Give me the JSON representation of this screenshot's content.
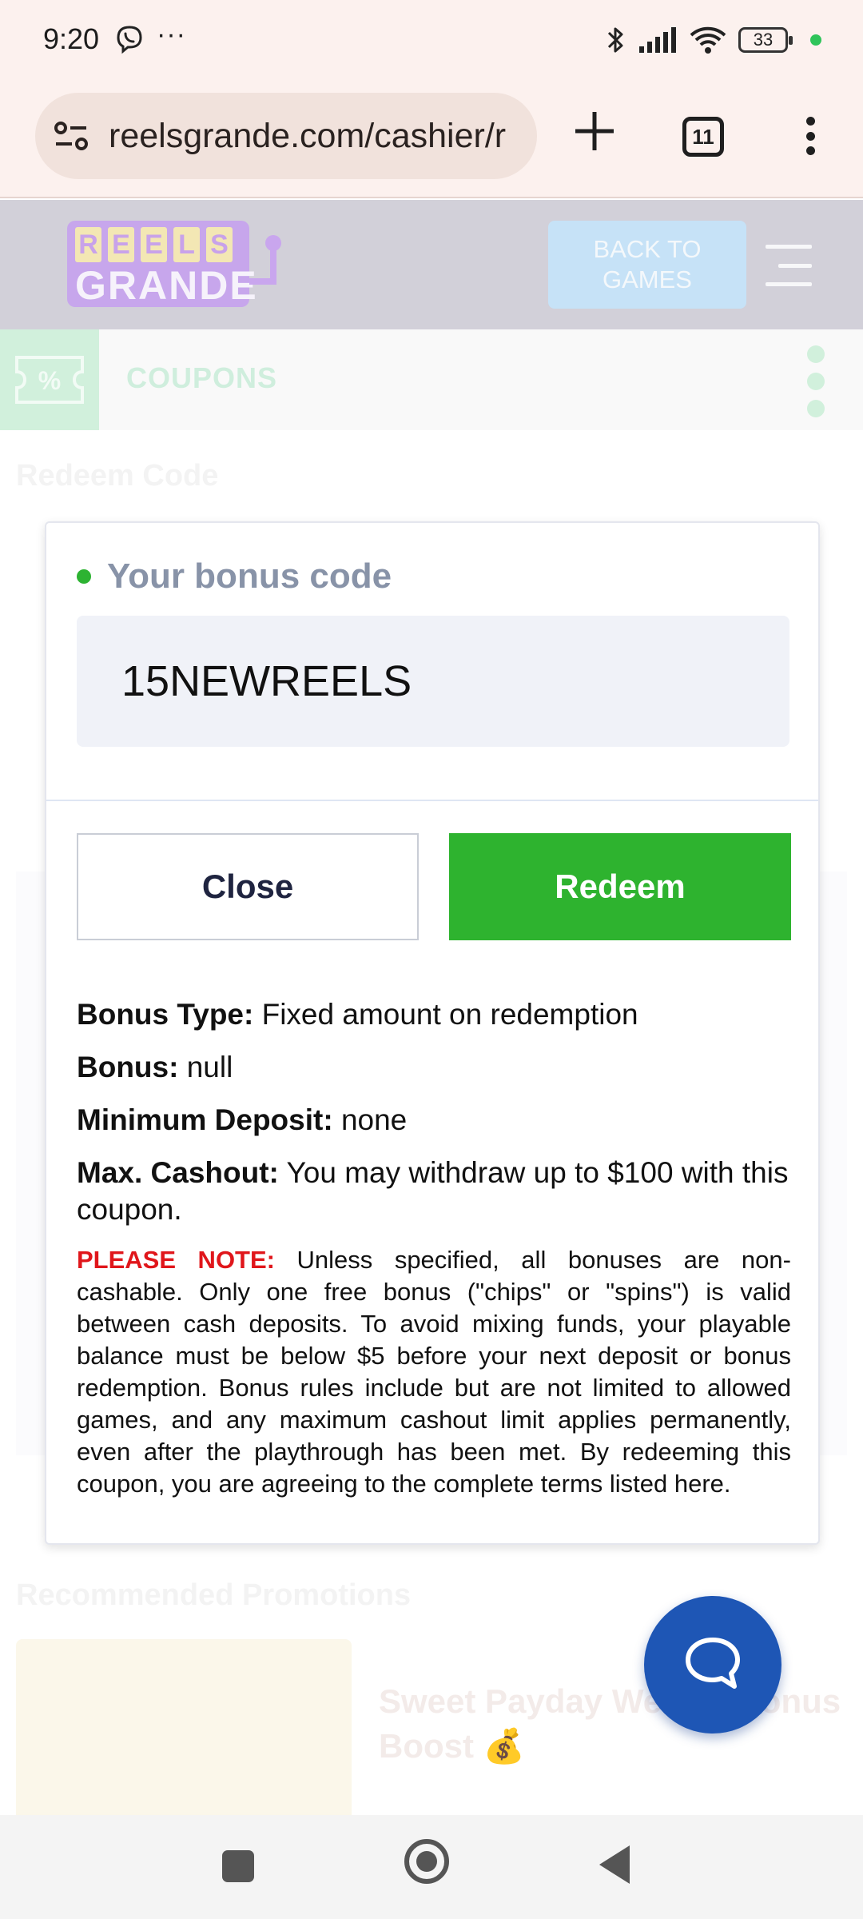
{
  "status_bar": {
    "time": "9:20",
    "notification_icons": [
      "viber-icon",
      "more-icon"
    ],
    "overflow_dots": "···",
    "battery_level": "33"
  },
  "browser": {
    "url": "reelsgrande.com/cashier/r",
    "tab_count": "11"
  },
  "site_header": {
    "logo_top_letters": [
      "R",
      "E",
      "E",
      "L",
      "S"
    ],
    "logo_bottom": "GRANDE",
    "back_button_label": "BACK TO GAMES"
  },
  "coupons_bar": {
    "label": "COUPONS"
  },
  "modal": {
    "code_label": "Your bonus code",
    "code_value": "15NEWREELS",
    "close_label": "Close",
    "redeem_label": "Redeem",
    "details": [
      {
        "label": "Bonus Type:",
        "value": "Fixed amount on redemption"
      },
      {
        "label": "Bonus:",
        "value": "null"
      },
      {
        "label": "Minimum Deposit:",
        "value": "none"
      },
      {
        "label": "Max. Cashout:",
        "value": "You may withdraw up to $100 with this coupon."
      }
    ],
    "note_label": "PLEASE NOTE:",
    "note_text": "Unless specified, all bonuses are non-cashable. Only one free bonus (\"chips\" or \"spins\") is valid between cash deposits. To avoid mixing funds, your playable balance must be below $5 before your next deposit or bonus redemption. Bonus rules include but are not limited to allowed games, and any maximum cashout limit applies permanently, even after the playthrough has been met. By redeeming this coupon, you are agreeing to the complete terms listed here."
  },
  "background": {
    "section_title": "Redeem Code",
    "promo_section_title": "Recommended Promotions",
    "promo_card_title": "Sweet Payday Weekly Bonus Boost 💰"
  },
  "colors": {
    "accent_green": "#2eb32f",
    "note_red": "#e0161b",
    "chat_blue": "#1e56b5"
  }
}
